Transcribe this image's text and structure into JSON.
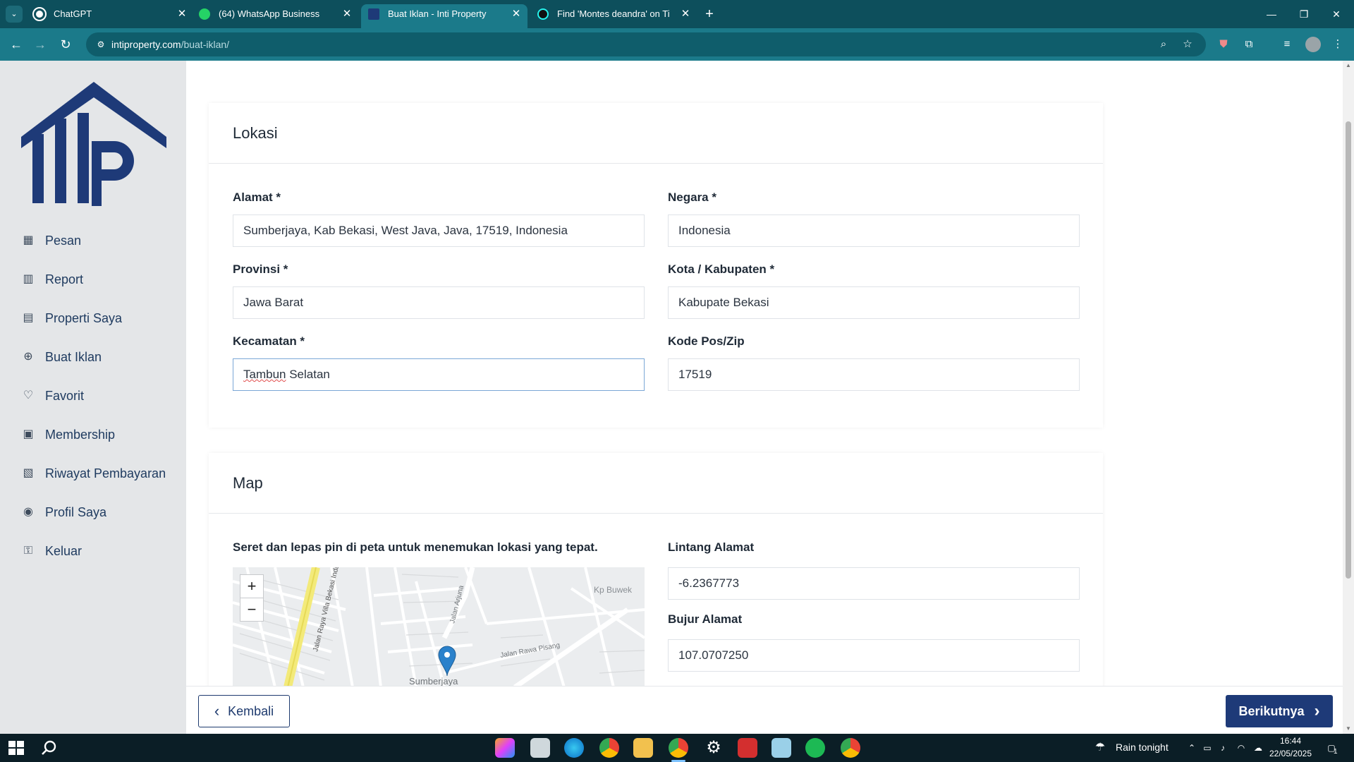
{
  "browser": {
    "tabs": [
      {
        "label": "ChatGPT",
        "icon": "chatgpt-icon",
        "active": false
      },
      {
        "label": "(64) WhatsApp Business",
        "icon": "whatsapp-icon",
        "active": false
      },
      {
        "label": "Buat Iklan - Inti Property",
        "icon": "intiproperty-icon",
        "active": true
      },
      {
        "label": "Find 'Montes deandra' on TikTok",
        "icon": "tiktok-icon",
        "active": false
      }
    ],
    "url_host": "intiproperty.com",
    "url_path": "/buat-iklan/"
  },
  "sidebar": {
    "items": [
      {
        "label": "Pesan",
        "icon": "dashboard-icon"
      },
      {
        "label": "Report",
        "icon": "bar-chart-icon"
      },
      {
        "label": "Properti Saya",
        "icon": "building-icon"
      },
      {
        "label": "Buat Iklan",
        "icon": "plus-circle-icon"
      },
      {
        "label": "Favorit",
        "icon": "heart-icon"
      },
      {
        "label": "Membership",
        "icon": "clipboard-icon"
      },
      {
        "label": "Riwayat Pembayaran",
        "icon": "receipt-icon"
      },
      {
        "label": "Profil Saya",
        "icon": "user-circle-icon"
      },
      {
        "label": "Keluar",
        "icon": "lock-icon"
      }
    ]
  },
  "lokasi": {
    "title": "Lokasi",
    "alamat_label": "Alamat *",
    "alamat_value": "Sumberjaya, Kab Bekasi, West Java, Java, 17519, Indonesia",
    "negara_label": "Negara *",
    "negara_value": "Indonesia",
    "provinsi_label": "Provinsi *",
    "provinsi_value": "Jawa Barat",
    "kota_label": "Kota / Kabupaten *",
    "kota_value": "Kabupate Bekasi",
    "kecamatan_label": "Kecamatan *",
    "kecamatan_value_misspelled": "Tambun",
    "kecamatan_value_rest": " Selatan",
    "kodepos_label": "Kode Pos/Zip",
    "kodepos_value": "17519"
  },
  "map_section": {
    "title": "Map",
    "instruction": "Seret dan lepas pin di peta untuk menemukan lokasi yang tepat.",
    "lintang_label": "Lintang Alamat",
    "lintang_value": "-6.2367773",
    "bujur_label": "Bujur Alamat",
    "bujur_value": "107.0707250",
    "zoom_in": "+",
    "zoom_out": "−",
    "map_labels": [
      "Kp Buwek",
      "Jalan Rawa Pisang",
      "Sumberjaya",
      "Jalan Raya Villa Bekasi Indah",
      "Jalan Arjuna"
    ]
  },
  "footer": {
    "back_label": "Kembali",
    "next_label": "Berikutnya"
  },
  "taskbar": {
    "weather": "Rain tonight",
    "time": "16:44",
    "date": "22/05/2025",
    "notification_count": "1"
  },
  "colors": {
    "brand_navy": "#1e3a78",
    "browser_teal": "#1b7a8a",
    "tabstrip": "#0d4f5c"
  }
}
